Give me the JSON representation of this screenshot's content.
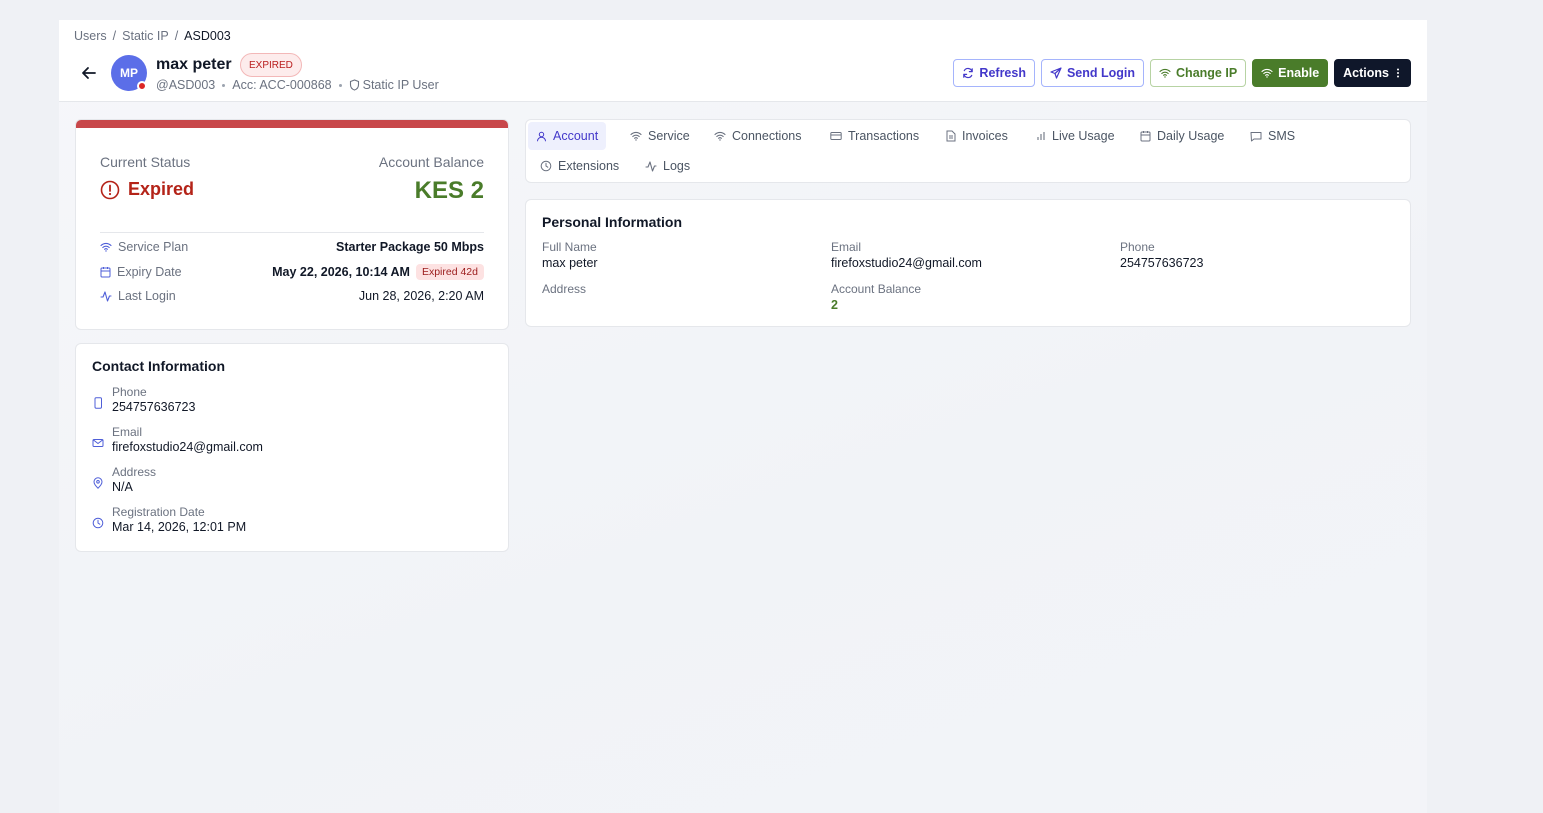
{
  "breadcrumb": [
    "Users",
    "Static IP",
    "ASD003"
  ],
  "user": {
    "initials": "MP",
    "name": "max peter",
    "status_badge": "EXPIRED",
    "handle": "@ASD003",
    "account": "Acc: ACC-000868",
    "type": "Static IP User"
  },
  "actions": {
    "refresh": "Refresh",
    "send_login": "Send Login",
    "change_ip": "Change IP",
    "enable": "Enable",
    "more": "Actions"
  },
  "status": {
    "current_status_label": "Current Status",
    "current_status": "Expired",
    "balance_label": "Account Balance",
    "balance": "KES 2",
    "service_plan_label": "Service Plan",
    "service_plan": "Starter Package 50 Mbps",
    "expiry_label": "Expiry Date",
    "expiry": "May 22, 2026, 10:14 AM",
    "expiry_badge": "Expired 42d",
    "last_login_label": "Last Login",
    "last_login": "Jun 28, 2026, 2:20 AM"
  },
  "contact": {
    "title": "Contact Information",
    "phone_label": "Phone",
    "phone": "254757636723",
    "email_label": "Email",
    "email": "firefoxstudio24@gmail.com",
    "address_label": "Address",
    "address": "N/A",
    "registration_label": "Registration Date",
    "registration": "Mar 14, 2026, 12:01 PM"
  },
  "tabs": [
    "Account",
    "Service",
    "Connections",
    "Transactions",
    "Invoices",
    "Live Usage",
    "Daily Usage",
    "SMS",
    "Extensions",
    "Logs"
  ],
  "active_tab": "Account",
  "personal": {
    "title": "Personal Information",
    "full_name_label": "Full Name",
    "full_name": "max peter",
    "email_label": "Email",
    "email": "firefoxstudio24@gmail.com",
    "phone_label": "Phone",
    "phone": "254757636723",
    "address_label": "Address",
    "address": "",
    "balance_label": "Account Balance",
    "balance": "2"
  },
  "colors": {
    "expired_red": "#b42318",
    "balance_green": "#4a7c2a",
    "primary_indigo": "#4338ca",
    "avatar": "#5b6ee8"
  }
}
